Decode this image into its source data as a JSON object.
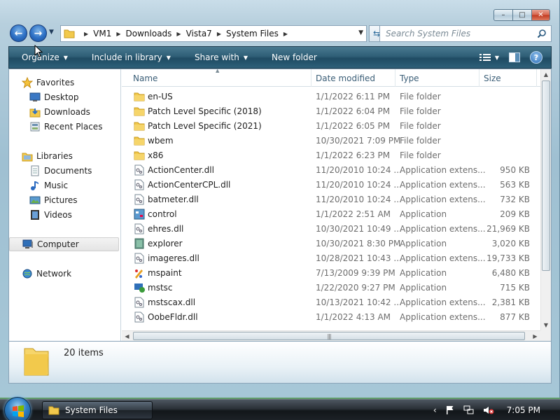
{
  "window": {
    "controls": {
      "minimize": "–",
      "maximize": "□",
      "close": "✕"
    }
  },
  "navigation": {
    "back_icon": "back-arrow-icon",
    "forward_icon": "forward-arrow-icon",
    "breadcrumbs": [
      "VM1",
      "Downloads",
      "Vista7",
      "System Files"
    ],
    "search_placeholder": "Search System Files"
  },
  "toolbar": {
    "organize": "Organize",
    "include_in_library": "Include in library",
    "share_with": "Share with",
    "new_folder": "New folder"
  },
  "sidebar": {
    "favorites_label": "Favorites",
    "favorites": [
      "Desktop",
      "Downloads",
      "Recent Places"
    ],
    "libraries_label": "Libraries",
    "libraries": [
      "Documents",
      "Music",
      "Pictures",
      "Videos"
    ],
    "computer_label": "Computer",
    "network_label": "Network"
  },
  "columns": {
    "name": "Name",
    "date": "Date modified",
    "type": "Type",
    "size": "Size"
  },
  "files": [
    {
      "name": "en-US",
      "date": "1/1/2022 6:11 PM",
      "type": "File folder",
      "size": "",
      "icon": "folder"
    },
    {
      "name": "Patch Level Specific (2018)",
      "date": "1/1/2022 6:04 PM",
      "type": "File folder",
      "size": "",
      "icon": "folder"
    },
    {
      "name": "Patch Level Specific (2021)",
      "date": "1/1/2022 6:05 PM",
      "type": "File folder",
      "size": "",
      "icon": "folder"
    },
    {
      "name": "wbem",
      "date": "10/30/2021 7:09 PM",
      "type": "File folder",
      "size": "",
      "icon": "folder"
    },
    {
      "name": "x86",
      "date": "1/1/2022 6:23 PM",
      "type": "File folder",
      "size": "",
      "icon": "folder"
    },
    {
      "name": "ActionCenter.dll",
      "date": "11/20/2010 10:24 ...",
      "type": "Application extens...",
      "size": "950 KB",
      "icon": "dll"
    },
    {
      "name": "ActionCenterCPL.dll",
      "date": "11/20/2010 10:24 ...",
      "type": "Application extens...",
      "size": "563 KB",
      "icon": "dll"
    },
    {
      "name": "batmeter.dll",
      "date": "11/20/2010 10:24 ...",
      "type": "Application extens...",
      "size": "732 KB",
      "icon": "dll"
    },
    {
      "name": "control",
      "date": "1/1/2022 2:51 AM",
      "type": "Application",
      "size": "209 KB",
      "icon": "control"
    },
    {
      "name": "ehres.dll",
      "date": "10/30/2021 10:49 ...",
      "type": "Application extens...",
      "size": "21,969 KB",
      "icon": "dll"
    },
    {
      "name": "explorer",
      "date": "10/30/2021 8:30 PM",
      "type": "Application",
      "size": "3,020 KB",
      "icon": "explorer"
    },
    {
      "name": "imageres.dll",
      "date": "10/28/2021 10:43 ...",
      "type": "Application extens...",
      "size": "19,733 KB",
      "icon": "dll"
    },
    {
      "name": "mspaint",
      "date": "7/13/2009 9:39 PM",
      "type": "Application",
      "size": "6,480 KB",
      "icon": "paint"
    },
    {
      "name": "mstsc",
      "date": "1/22/2020 9:27 PM",
      "type": "Application",
      "size": "715 KB",
      "icon": "mstsc"
    },
    {
      "name": "mstscax.dll",
      "date": "10/13/2021 10:42 ...",
      "type": "Application extens...",
      "size": "2,381 KB",
      "icon": "dll"
    },
    {
      "name": "OobeFldr.dll",
      "date": "1/1/2022 4:13 AM",
      "type": "Application extens...",
      "size": "877 KB",
      "icon": "dll"
    }
  ],
  "status": {
    "item_count": "20 items"
  },
  "taskbar": {
    "window_button": "System Files",
    "clock": "7:05 PM"
  },
  "colors": {
    "accent": "#2f5f77",
    "folder": "#f2c94c"
  }
}
